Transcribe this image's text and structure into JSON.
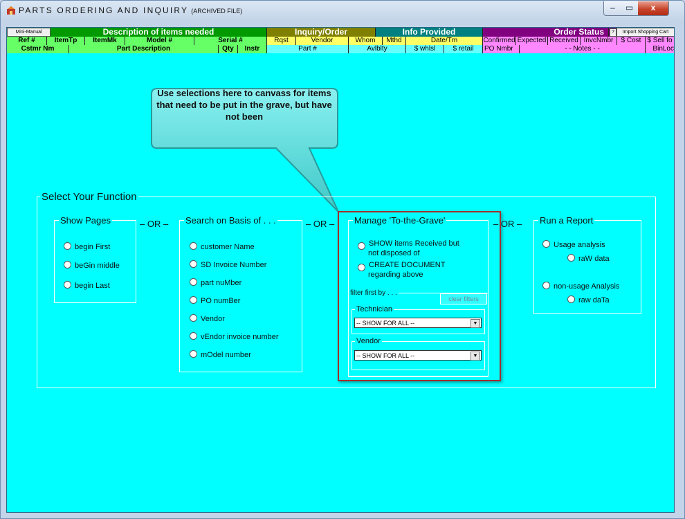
{
  "window": {
    "title": "PARTS ORDERING AND INQUIRY",
    "title_suffix": "(ARCHIVED FILE)",
    "min": "–",
    "max": "▭",
    "close": "x"
  },
  "header": {
    "mini_manual": "Mini-Manual",
    "desc_group": "Description of items needed",
    "inquiry_group": "Inquiry/Order",
    "info_group": "Info Provided",
    "status_group": "Order Status",
    "help": "?",
    "import_cart": "Import Shopping Cart",
    "row2": [
      "Ref #",
      "ItemTp",
      "ItemMk",
      "Model #",
      "Serial #",
      "Rqst",
      "Vendor",
      "Whom",
      "Mthd",
      "Date/Tm",
      "Confirmed",
      "Expected",
      "Received",
      "InvcNmbr",
      "$ Cost",
      "$ Sell fo"
    ],
    "row3": [
      "Cstmr Nm",
      "Part Description",
      "Qty",
      "Instr",
      "Part #",
      "Avlblty",
      "$ whlsl",
      "$ retail",
      "PO Nmbr",
      "- - Notes - -",
      "BinLoc"
    ]
  },
  "callout": {
    "text": "Use selections here to canvass for items that need to be put in the grave, but have not been"
  },
  "main": {
    "title": "Select Your Function",
    "or_label": "– OR –",
    "show_pages": {
      "title": "Show Pages",
      "options": [
        "begin First",
        "beGin middle",
        "begin Last"
      ]
    },
    "search": {
      "title": "Search on Basis of . . .",
      "options": [
        "customer Name",
        "SD Invoice Number",
        "part nuMber",
        "PO numBer",
        "Vendor",
        "vEndor invoice number",
        "mOdel number"
      ]
    },
    "grave": {
      "title": "Manage 'To-the-Grave'",
      "opt1_line1": "SHOW items Received but",
      "opt1_line2": "not disposed of",
      "opt2_line1": "CREATE DOCUMENT",
      "opt2_line2": "regarding  above",
      "filter_label": "filter first by . . .",
      "clear_filters": "clear filters",
      "technician_label": "Technician",
      "technician_value": "-- SHOW FOR ALL --",
      "vendor_label": "Vendor",
      "vendor_value": "-- SHOW FOR ALL --"
    },
    "report": {
      "title": "Run a Report",
      "usage": "Usage analysis",
      "raw_w": "raW data",
      "non_usage": "non-usage Analysis",
      "raw_t": "raw daTa"
    }
  },
  "colors": {
    "client_bg": "#00ffff",
    "desc_green": "#009900",
    "inquiry_olive": "#808000",
    "info_teal": "#008080",
    "status_purple": "#800080"
  }
}
